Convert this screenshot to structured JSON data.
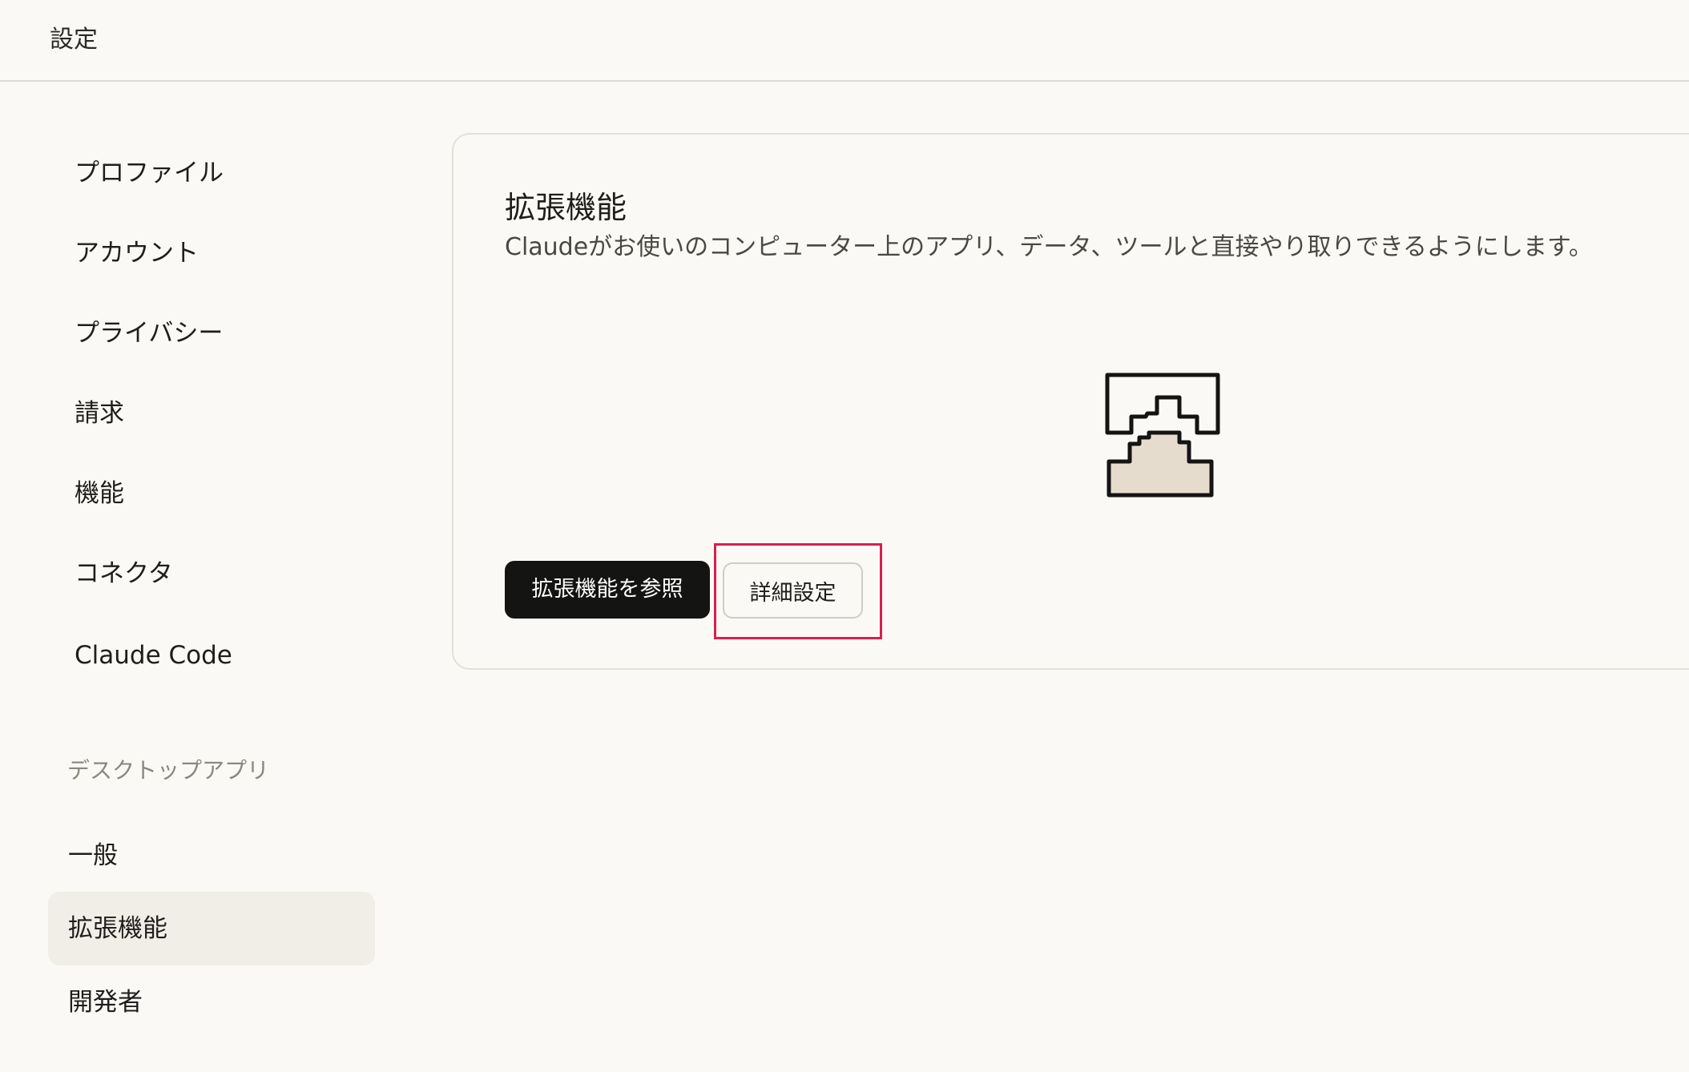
{
  "header": {
    "title": "設定"
  },
  "sidebar": {
    "items": [
      {
        "label": "プロファイル"
      },
      {
        "label": "アカウント"
      },
      {
        "label": "プライバシー"
      },
      {
        "label": "請求"
      },
      {
        "label": "機能"
      },
      {
        "label": "コネクタ"
      },
      {
        "label": "Claude Code"
      }
    ],
    "desktop_section_label": "デスクトップアプリ",
    "desktop_items": [
      {
        "label": "一般"
      },
      {
        "label": "拡張機能",
        "active": true
      },
      {
        "label": "開発者"
      }
    ]
  },
  "main": {
    "title": "拡張機能",
    "description": "Claudeがお使いのコンピューター上のアプリ、データ、ツールと直接やり取りできるようにします。",
    "illustration_icon": "extension-blocks-icon",
    "browse_button_label": "拡張機能を参照",
    "advanced_button_label": "詳細設定"
  },
  "colors": {
    "background": "#faf9f5",
    "primary_button": "#141413",
    "active_nav": "#f0eee7",
    "highlight": "#d6204e",
    "illustration_fill": "#e6dccd"
  }
}
